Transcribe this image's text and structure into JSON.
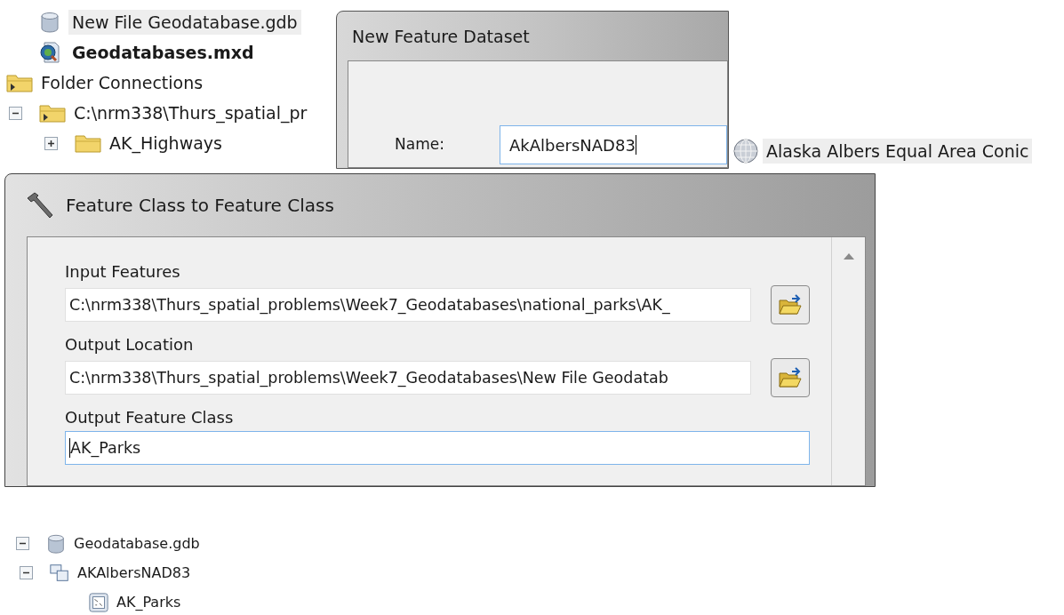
{
  "catalog_tree_top": {
    "partial_items": [
      {
        "label": "New File Geodatabase.gdb",
        "kind": "database",
        "selected": true,
        "current": false
      },
      {
        "label": "Geodatabases.mxd",
        "kind": "map_document",
        "selected": false,
        "current": true
      }
    ],
    "items": [
      {
        "label": "Folder Connections",
        "kind": "folder_connection",
        "children": [
          {
            "label": "C:\\nrm338\\Thurs_spatial_pr",
            "kind": "folder_connection",
            "expanded": true,
            "children": [
              {
                "label": "AK_Highways",
                "kind": "folder",
                "expanded": false
              }
            ]
          }
        ]
      }
    ]
  },
  "new_feature_dataset_dialog": {
    "title": "New Feature Dataset",
    "name_label": "Name:",
    "name_value": "AkAlbersNAD83"
  },
  "coordinate_system": {
    "label": "Alaska Albers Equal Area Conic"
  },
  "feature_class_to_feature_class_dialog": {
    "title": "Feature Class to Feature Class",
    "fields": [
      {
        "label": "Input Features",
        "value": "C:\\nrm338\\Thurs_spatial_problems\\Week7_Geodatabases\\national_parks\\AK_",
        "kind": "browse",
        "focused": false
      },
      {
        "label": "Output Location",
        "value": "C:\\nrm338\\Thurs_spatial_problems\\Week7_Geodatabases\\New File Geodatab",
        "kind": "browse",
        "focused": false
      },
      {
        "label": "Output Feature Class",
        "value": "AK_Parks",
        "kind": "text",
        "focused": true
      }
    ]
  },
  "catalog_tree_bottom": {
    "items": [
      {
        "label": "Geodatabase.gdb",
        "kind": "database",
        "expanded": true,
        "children": [
          {
            "label": "AKAlbersNAD83",
            "kind": "feature_dataset",
            "expanded": true,
            "children": [
              {
                "label": "AK_Parks",
                "kind": "feature_class"
              }
            ]
          }
        ]
      }
    ]
  }
}
